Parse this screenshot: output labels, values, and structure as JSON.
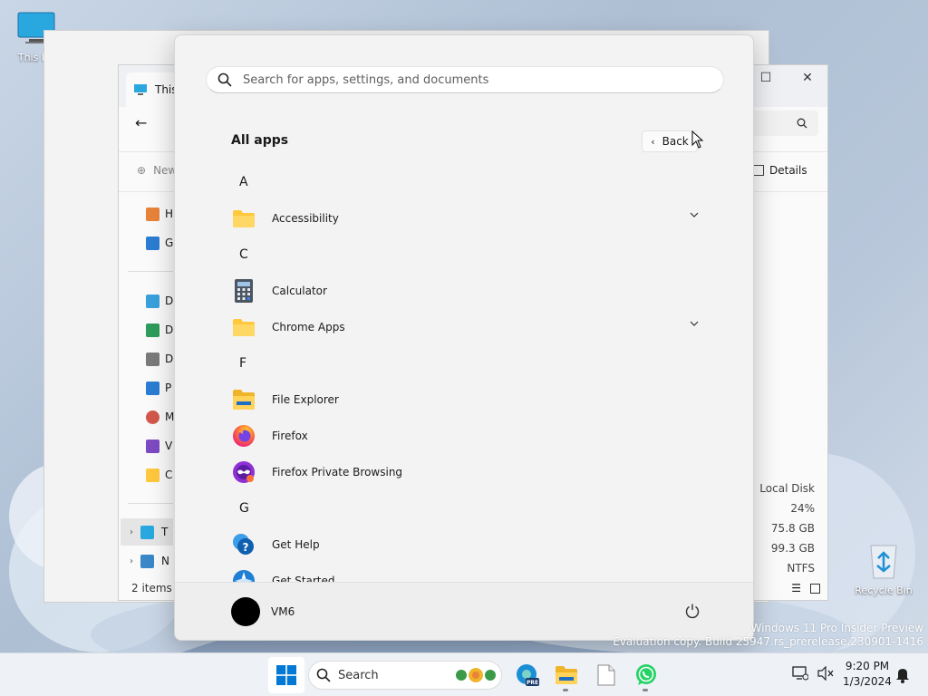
{
  "desktop": {
    "icons": [
      {
        "label": "This PC"
      },
      {
        "label": "Recycle Bin"
      }
    ],
    "watermark": {
      "line1": "Windows 11 Pro Insider Preview",
      "line2": "Evaluation copy. Build 25947.rs_prerelease.230901-1416"
    }
  },
  "explorer": {
    "tab_label": "This",
    "cmd_new": "New",
    "details_label": "Details",
    "nav_items": [
      {
        "label": "H",
        "icon": "home-icon"
      },
      {
        "label": "G",
        "icon": "gallery-icon"
      },
      {
        "label": "D",
        "icon": "desktop-folder-icon"
      },
      {
        "label": "D",
        "icon": "downloads-icon"
      },
      {
        "label": "D",
        "icon": "documents-icon"
      },
      {
        "label": "P",
        "icon": "pictures-icon"
      },
      {
        "label": "M",
        "icon": "music-icon"
      },
      {
        "label": "V",
        "icon": "videos-icon"
      },
      {
        "label": "C",
        "icon": "folder-icon"
      },
      {
        "label": "T",
        "icon": "this-pc-icon"
      },
      {
        "label": "N",
        "icon": "network-icon"
      }
    ],
    "drive_info": {
      "type": "Local Disk",
      "percent_used": "24%",
      "free": "75.8 GB",
      "total": "99.3 GB",
      "filesystem": "NTFS"
    },
    "status": "2 items"
  },
  "start_menu": {
    "search_placeholder": "Search for apps, settings, and documents",
    "heading": "All apps",
    "back_label": "Back",
    "groups": [
      {
        "letter": "A",
        "apps": [
          {
            "name": "Accessibility",
            "icon": "folder-icon",
            "expandable": true
          }
        ]
      },
      {
        "letter": "C",
        "apps": [
          {
            "name": "Calculator",
            "icon": "calculator-icon",
            "expandable": false
          },
          {
            "name": "Chrome Apps",
            "icon": "folder-icon",
            "expandable": true
          }
        ]
      },
      {
        "letter": "F",
        "apps": [
          {
            "name": "File Explorer",
            "icon": "file-explorer-icon",
            "expandable": false
          },
          {
            "name": "Firefox",
            "icon": "firefox-icon",
            "expandable": false
          },
          {
            "name": "Firefox Private Browsing",
            "icon": "firefox-private-icon",
            "expandable": false
          }
        ]
      },
      {
        "letter": "G",
        "apps": [
          {
            "name": "Get Help",
            "icon": "get-help-icon",
            "expandable": false
          },
          {
            "name": "Get Started",
            "icon": "get-started-icon",
            "expandable": false
          }
        ]
      }
    ],
    "user_name": "VM6"
  },
  "taskbar": {
    "search_label": "Search",
    "time": "9:20 PM",
    "date": "1/3/2024"
  },
  "colors": {
    "accent": "#0067c0",
    "folder": "#ffc83d",
    "whatsapp": "#25d366"
  }
}
